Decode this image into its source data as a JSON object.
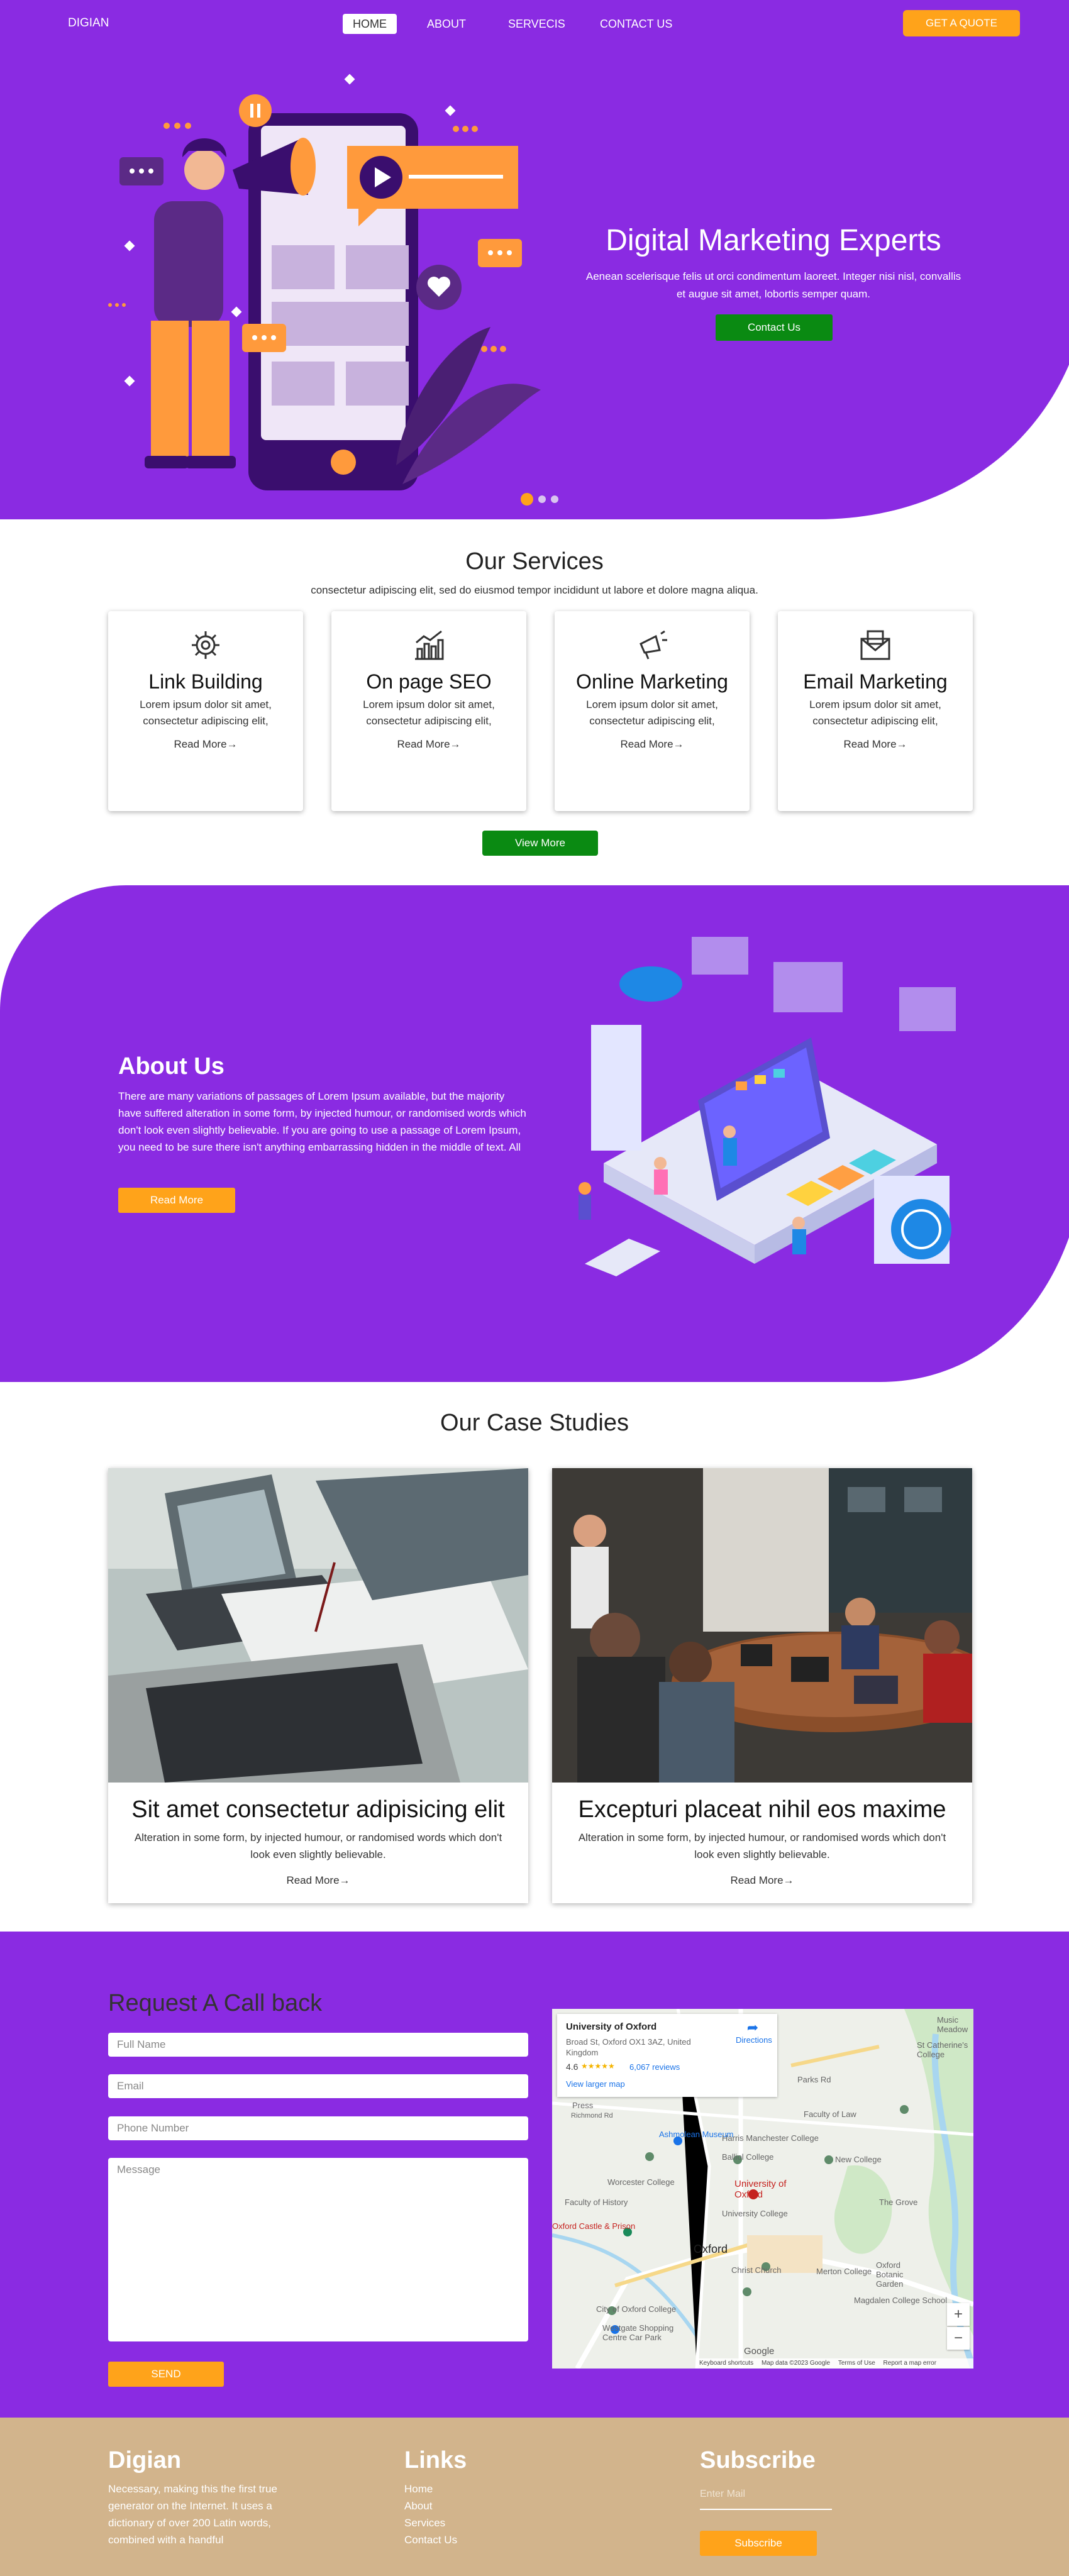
{
  "nav": {
    "brand": "DIGIAN",
    "items": [
      "HOME",
      "ABOUT",
      "SERVECIS",
      "CONTACT US"
    ],
    "cta": "GET A QUOTE"
  },
  "hero": {
    "title": "Digital Marketing Experts",
    "text": "Aenean scelerisque felis ut orci condimentum laoreet. Integer nisi nisl, convallis et augue sit amet, lobortis semper quam.",
    "button": "Contact Us"
  },
  "services": {
    "title": "Our Services",
    "subtitle": "consectetur adipiscing elit, sed do eiusmod tempor incididunt ut labore et dolore magna aliqua.",
    "cards": [
      {
        "title": "Link Building",
        "text": "Lorem ipsum dolor sit amet, consectetur adipiscing elit,",
        "link": "Read More→",
        "icon": "network-gear-icon"
      },
      {
        "title": "On page SEO",
        "text": "Lorem ipsum dolor sit amet, consectetur adipiscing elit,",
        "link": "Read More→",
        "icon": "growth-chart-icon"
      },
      {
        "title": "Online Marketing",
        "text": "Lorem ipsum dolor sit amet, consectetur adipiscing elit,",
        "link": "Read More→",
        "icon": "megaphone-icon"
      },
      {
        "title": "Email Marketing",
        "text": "Lorem ipsum dolor sit amet, consectetur adipiscing elit,",
        "link": "Read More→",
        "icon": "envelope-icon"
      }
    ],
    "view_more": "View More"
  },
  "about": {
    "title": "About Us",
    "text": "There are many variations of passages of Lorem Ipsum available, but the majority have suffered alteration in some form, by injected humour, or randomised words which don't look even slightly believable. If you are going to use a passage of Lorem Ipsum, you need to be sure there isn't anything embarrassing hidden in the middle of text. All",
    "button": "Read More"
  },
  "cases": {
    "title": "Our Case Studies",
    "items": [
      {
        "title": "Sit amet consectetur adipisicing elit",
        "text": "Alteration in some form, by injected humour, or randomised words which don't look even slightly believable.",
        "link": "Read More→"
      },
      {
        "title": "Excepturi placeat nihil eos maxime",
        "text": "Alteration in some form, by injected humour, or randomised words which don't look even slightly believable.",
        "link": "Read More→"
      }
    ]
  },
  "callback": {
    "title": "Request A Call back",
    "fields": {
      "name": "Full Name",
      "email": "Email",
      "phone": "Phone Number",
      "message": "Message"
    },
    "send": "SEND"
  },
  "map": {
    "place": "University of Oxford",
    "address": "Broad St, Oxford OX1 3AZ, United Kingdom",
    "rating": "4.6",
    "stars": "★★★★★",
    "reviews": "6,067 reviews",
    "larger": "View larger map",
    "directions": "Directions",
    "labels": [
      "Ashmolean Museum",
      "Harris Manchester College",
      "Balliol College",
      "Worcester College",
      "University of Oxford",
      "New College",
      "Faculty of History",
      "University College",
      "Oxford Castle & Prison",
      "Oxford",
      "Christ Church",
      "Merton College",
      "City of Oxford College",
      "Westgate Shopping Centre Car Park",
      "Oxford Botanic Garden",
      "Magdalen College School",
      "Faculty of Law",
      "The Grove",
      "St Catherine's College",
      "Music Meadow",
      "Parks Rd",
      "Press",
      "Richmond Rd"
    ],
    "footer": [
      "Keyboard shortcuts",
      "Map data ©2023 Google",
      "Terms of Use",
      "Report a map error"
    ],
    "zoom_in": "+",
    "zoom_out": "−",
    "google": "Google"
  },
  "footer": {
    "brand": "Digian",
    "brand_text": "Necessary, making this the first true generator on the Internet. It uses a dictionary of over 200 Latin words, combined with a handful",
    "links_title": "Links",
    "links": [
      "Home",
      "About",
      "Services",
      "Contact Us"
    ],
    "subscribe_title": "Subscribe",
    "mail_placeholder": "Enter Mail",
    "subscribe_btn": "Subscribe"
  },
  "colors": {
    "purple": "#8a2be2",
    "orange": "#ffa31a",
    "green": "#0a8a12",
    "tan": "#d2b48c"
  }
}
